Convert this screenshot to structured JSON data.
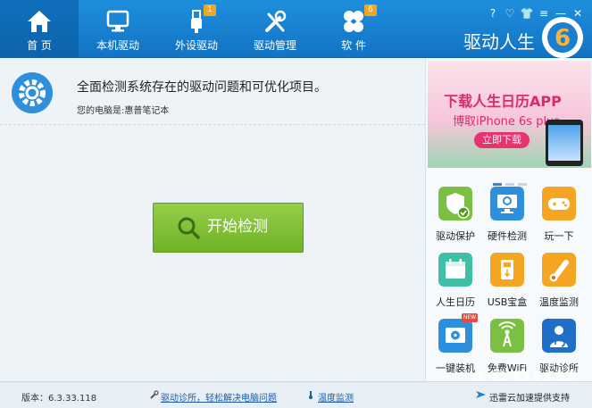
{
  "nav": {
    "tabs": [
      {
        "label": "首 页",
        "icon": "home-icon"
      },
      {
        "label": "本机驱动",
        "icon": "monitor-icon"
      },
      {
        "label": "外设驱动",
        "icon": "usb-icon",
        "badge": "1"
      },
      {
        "label": "驱动管理",
        "icon": "tools-icon"
      },
      {
        "label": "软 件",
        "icon": "apps-icon",
        "badge": "6"
      }
    ],
    "window_controls": [
      "?",
      "♡",
      "👕",
      "≡",
      "—",
      "✕"
    ],
    "brand_text": "驱动人生",
    "brand_logo_text": "6"
  },
  "main": {
    "headline": "全面检测系统存在的驱动问题和可优化项目。",
    "device_info": "您的电脑是:惠普笔记本",
    "scan_button": "开始检测"
  },
  "sidebar": {
    "banner": {
      "title": "下载人生日历APP",
      "subtitle": "博取iPhone 6s plus",
      "button": "立即下载"
    },
    "tools": [
      {
        "label": "驱动保护",
        "icon": "shield-check-icon",
        "color": "#7bc043"
      },
      {
        "label": "硬件检测",
        "icon": "monitor-scan-icon",
        "color": "#2e8fdc"
      },
      {
        "label": "玩一下",
        "icon": "gamepad-icon",
        "color": "#f4a623"
      },
      {
        "label": "人生日历",
        "icon": "calendar-icon",
        "color": "#3fbfa5"
      },
      {
        "label": "USB宝盒",
        "icon": "usb-box-icon",
        "color": "#f4a623"
      },
      {
        "label": "温度监测",
        "icon": "thermometer-icon",
        "color": "#f4a623"
      },
      {
        "label": "一键装机",
        "icon": "disc-install-icon",
        "color": "#2e8fdc",
        "badge": "NEW"
      },
      {
        "label": "免费WiFi",
        "icon": "wifi-tower-icon",
        "color": "#7bc043"
      },
      {
        "label": "驱动诊所",
        "icon": "doctor-icon",
        "color": "#1f6fc8"
      }
    ]
  },
  "status": {
    "version": "版本：6.3.33.118",
    "link_diagnose": "驱动诊所，轻松解决电脑问题",
    "link_temp": "温度监测",
    "xunlei": "迅雷云加速提供支持",
    "watermark": "ARPUN"
  }
}
